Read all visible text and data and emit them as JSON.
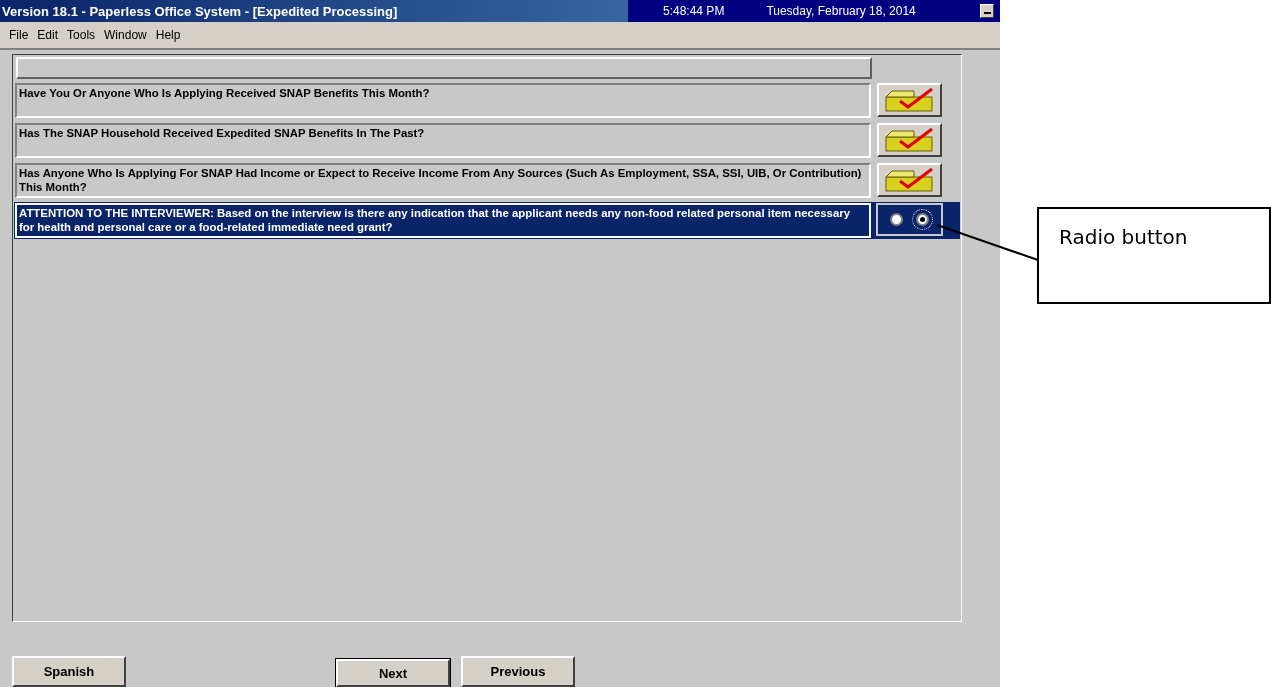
{
  "window": {
    "title": "Version 18.1 - Paperless Office System - [Expedited Processing]",
    "time": "5:48:44 PM",
    "date": "Tuesday, February 18, 2014"
  },
  "menu": [
    "File",
    "Edit",
    "Tools",
    "Window",
    "Help"
  ],
  "questions": [
    {
      "text": "Have You Or Anyone Who Is Applying Received SNAP Benefits This Month?",
      "kind": "checkmark",
      "selected": false
    },
    {
      "text": "Has The SNAP Household Received Expedited SNAP Benefits In The Past?",
      "kind": "checkmark",
      "selected": false
    },
    {
      "text": "Has Anyone Who Is Applying For SNAP Had Income or Expect to Receive Income From Any Sources (Such As Employment, SSA, SSI, UIB, Or Contribution) This Month?",
      "kind": "checkmark",
      "selected": false
    },
    {
      "text": "ATTENTION TO THE INTERVIEWER: Based on the interview is there any indication that the applicant needs any non-food related personal item necessary for health and personal care or a food-related immediate need grant?",
      "kind": "radio",
      "selected": true,
      "options": [
        {
          "selected": false
        },
        {
          "selected": true
        }
      ]
    }
  ],
  "buttons": [
    "Spanish",
    "Next",
    "Previous"
  ],
  "callout": {
    "text": "Radio button"
  }
}
